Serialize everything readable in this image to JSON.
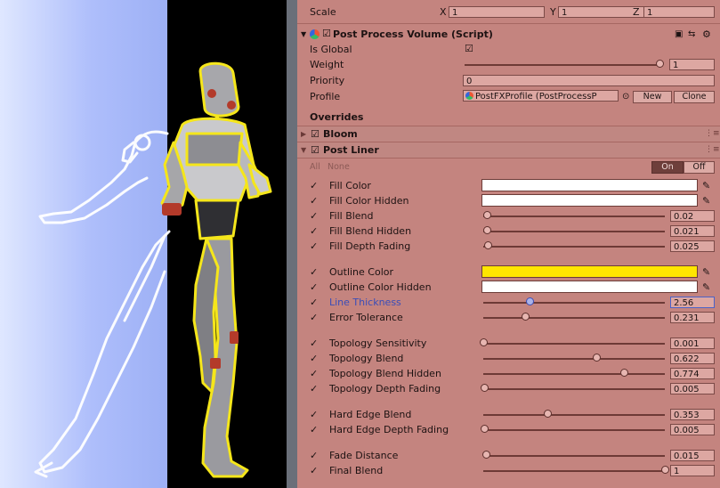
{
  "transform": {
    "scale_label": "Scale",
    "x_label": "X",
    "x_value": "1",
    "y_label": "Y",
    "y_value": "1",
    "z_label": "Z",
    "z_value": "1"
  },
  "component": {
    "title": "Post Process Volume (Script)",
    "enabled": true,
    "is_global_label": "Is Global",
    "is_global": true,
    "weight_label": "Weight",
    "weight_value": "1",
    "weight_fraction": 1.0,
    "priority_label": "Priority",
    "priority_value": "0",
    "profile_label": "Profile",
    "profile_value": "PostFXProfile (PostProcessP",
    "new_label": "New",
    "clone_label": "Clone"
  },
  "overrides": {
    "heading": "Overrides",
    "bloom_label": "Bloom",
    "postliner_label": "Post Liner",
    "all_label": "All",
    "none_label": "None",
    "on_label": "On",
    "off_label": "Off"
  },
  "params": [
    {
      "label": "Fill Color",
      "type": "color",
      "color": "#ffffff"
    },
    {
      "label": "Fill Color Hidden",
      "type": "color",
      "color": "#ffffff"
    },
    {
      "label": "Fill Blend",
      "type": "slider",
      "value": "0.02",
      "fraction": 0.02
    },
    {
      "label": "Fill Blend Hidden",
      "type": "slider",
      "value": "0.021",
      "fraction": 0.021
    },
    {
      "label": "Fill Depth Fading",
      "type": "slider",
      "value": "0.025",
      "fraction": 0.025
    },
    {
      "label": "Outline Color",
      "type": "color",
      "color": "#ffe600"
    },
    {
      "label": "Outline Color Hidden",
      "type": "color",
      "color": "#ffffff"
    },
    {
      "label": "Line Thickness",
      "type": "slider",
      "value": "2.56",
      "fraction": 0.256,
      "active": true
    },
    {
      "label": "Error Tolerance",
      "type": "slider",
      "value": "0.231",
      "fraction": 0.231
    },
    {
      "label": "Topology Sensitivity",
      "type": "slider",
      "value": "0.001",
      "fraction": 0.001
    },
    {
      "label": "Topology Blend",
      "type": "slider",
      "value": "0.622",
      "fraction": 0.622
    },
    {
      "label": "Topology Blend Hidden",
      "type": "slider",
      "value": "0.774",
      "fraction": 0.774
    },
    {
      "label": "Topology Depth Fading",
      "type": "slider",
      "value": "0.005",
      "fraction": 0.005
    },
    {
      "label": "Hard Edge Blend",
      "type": "slider",
      "value": "0.353",
      "fraction": 0.353
    },
    {
      "label": "Hard Edge Depth Fading",
      "type": "slider",
      "value": "0.005",
      "fraction": 0.005
    },
    {
      "label": "Fade Distance",
      "type": "slider",
      "value": "0.015",
      "fraction": 0.015
    },
    {
      "label": "Final Blend",
      "type": "slider",
      "value": "1",
      "fraction": 1.0
    }
  ],
  "colors": {
    "inspector_bg": "#c4847f",
    "outline_yellow": "#ffe600",
    "active_blue": "#4b62c9",
    "viewport_blue": "#aebefb"
  }
}
